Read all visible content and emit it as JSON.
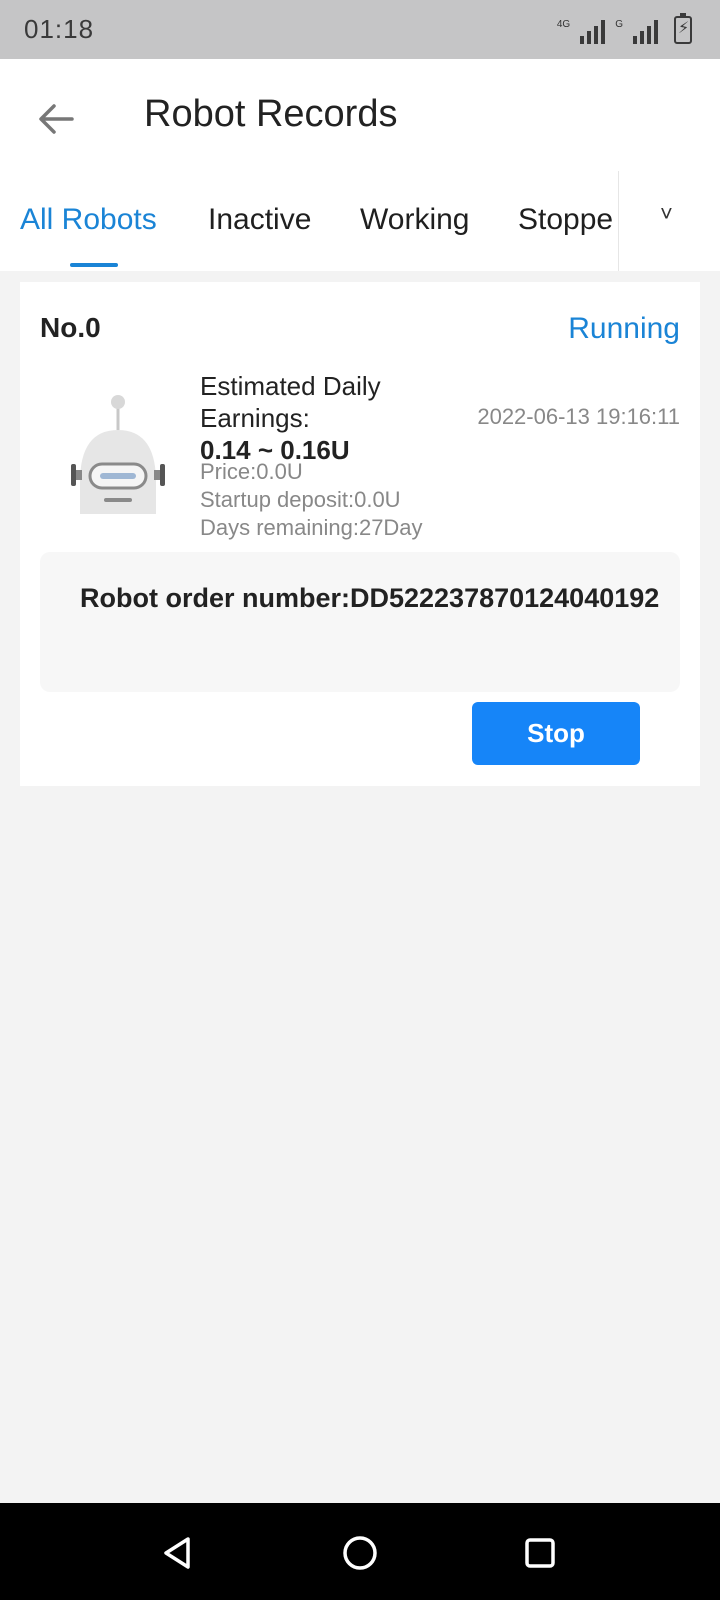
{
  "status_bar": {
    "time": "01:18",
    "network_label_1": "4G",
    "network_label_2": "G",
    "battery_symbol": "⚡"
  },
  "header": {
    "title": "Robot Records",
    "back_icon": "arrow-left-icon"
  },
  "tabs": {
    "items": [
      "All Robots",
      "Inactive",
      "Working",
      "Stoppe"
    ],
    "active_index": 0,
    "more_icon": "chevron-down-icon",
    "more_symbol": "˅"
  },
  "robot": {
    "number": "No.0",
    "status": "Running",
    "estimated_label": "Estimated Daily Earnings:",
    "estimated_range": "0.14 ~ 0.16U",
    "date": "2022-06-13 19:16:11",
    "price": "Price:0.0U",
    "deposit": "Startup deposit:0.0U",
    "days_remaining": "Days remaining:27Day",
    "order_number": "Robot order number:DD522237870124040192",
    "stop_label": "Stop"
  },
  "colors": {
    "accent": "#1a84d6",
    "button": "#1685f8",
    "page_bg": "#f3f3f3",
    "status_bar_bg": "#c5c5c6"
  },
  "nav": {
    "back_icon": "triangle-back-icon",
    "home_icon": "circle-home-icon",
    "recents_icon": "square-recents-icon"
  }
}
